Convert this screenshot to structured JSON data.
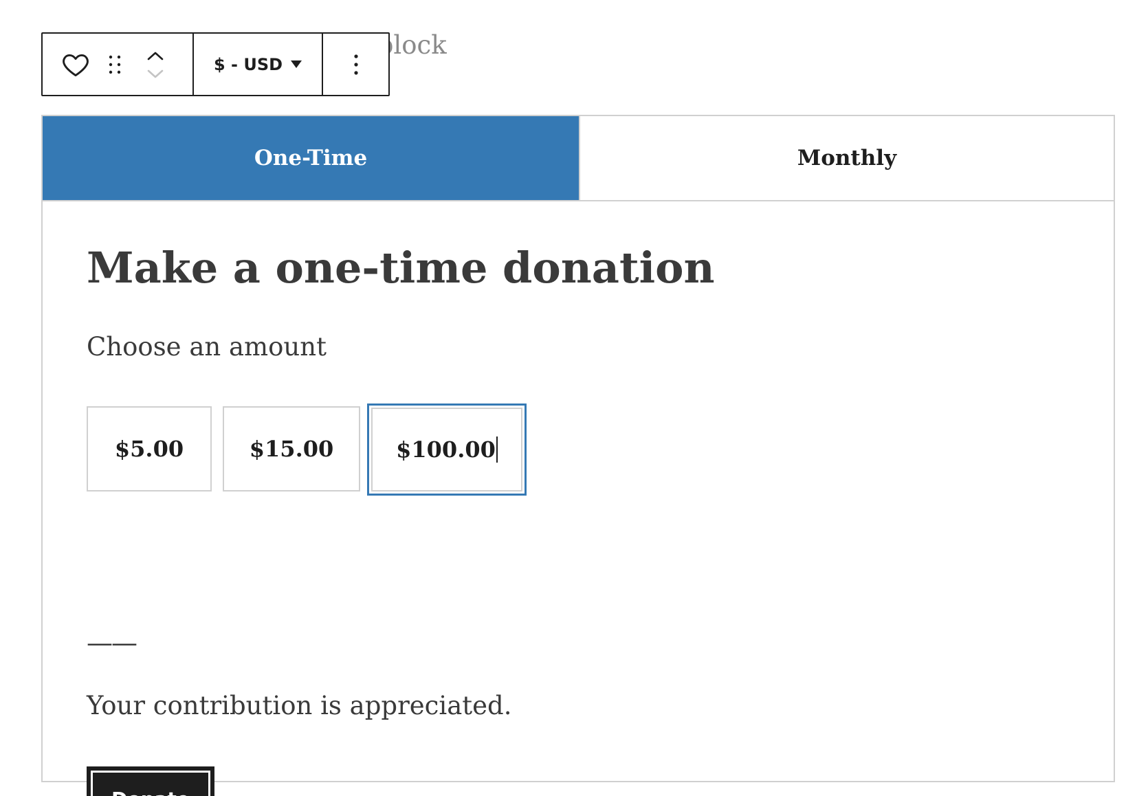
{
  "editor": {
    "placeholder_text": "ose a block"
  },
  "toolbar": {
    "block_icon": "heart-icon",
    "drag_handle_icon": "drag-handle-icon",
    "move_up_icon": "chevron-up-icon",
    "move_down_icon": "chevron-down-icon",
    "currency_label": "$ - USD",
    "more_options_icon": "more-vertical-icon"
  },
  "donation": {
    "tabs": [
      {
        "label": "One-Time",
        "active": true
      },
      {
        "label": "Monthly",
        "active": false
      }
    ],
    "heading": "Make a one-time donation",
    "choose_label": "Choose an amount",
    "amounts": [
      {
        "value": "$5.00"
      },
      {
        "value": "$15.00"
      },
      {
        "value": "$100.00",
        "focused": true
      }
    ],
    "separator": "——",
    "thanks_text": "Your contribution is appreciated.",
    "donate_label": "Donate"
  },
  "colors": {
    "accent": "#3579b4",
    "button_bg": "#1e1e1e",
    "border": "#d0d0d0",
    "text": "#3a3a3a"
  }
}
